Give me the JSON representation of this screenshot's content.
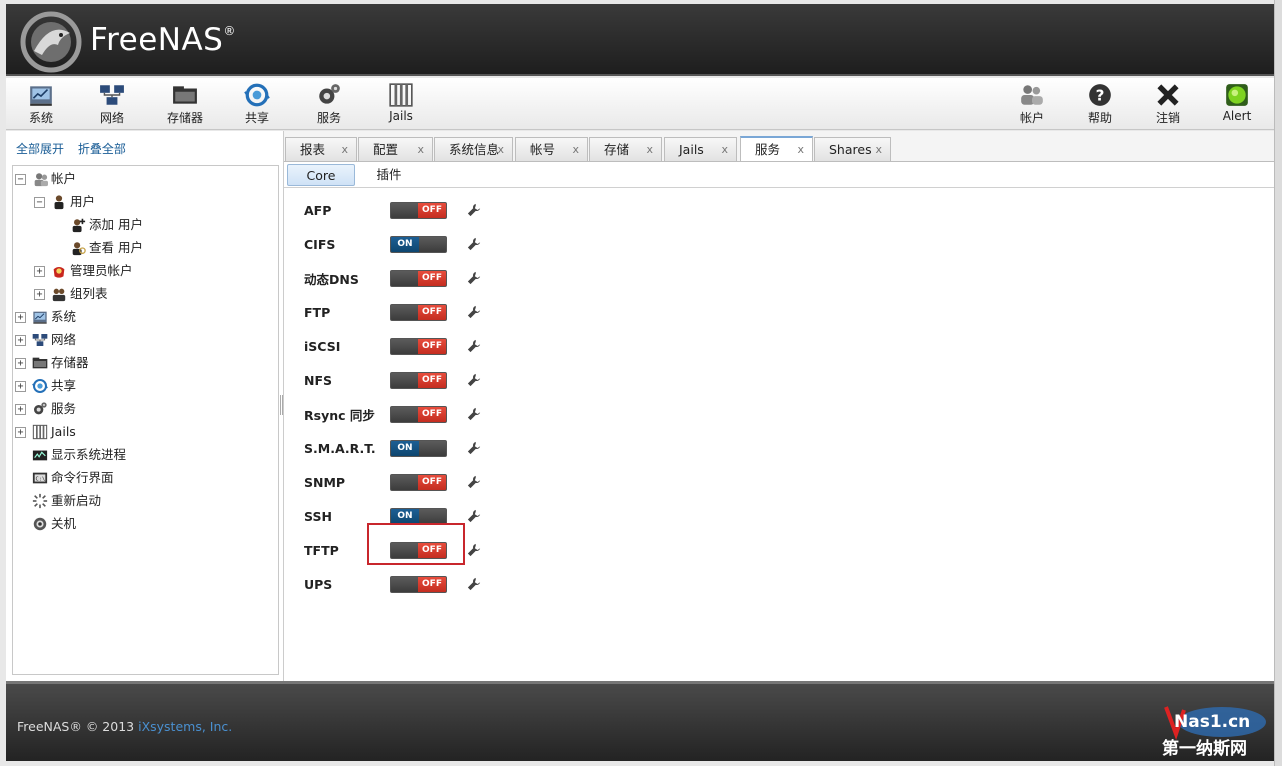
{
  "brand": {
    "name": "FreeNAS",
    "reg": "®"
  },
  "toolbar": {
    "left": [
      {
        "id": "system",
        "label": "系统",
        "icon": "system-icon"
      },
      {
        "id": "network",
        "label": "网络",
        "icon": "network-icon"
      },
      {
        "id": "storage",
        "label": "存储器",
        "icon": "storage-icon"
      },
      {
        "id": "sharing",
        "label": "共享",
        "icon": "sharing-icon"
      },
      {
        "id": "services",
        "label": "服务",
        "icon": "services-icon"
      },
      {
        "id": "jails",
        "label": "Jails",
        "icon": "jails-icon"
      }
    ],
    "right": [
      {
        "id": "account",
        "label": "帐户",
        "icon": "account-icon"
      },
      {
        "id": "help",
        "label": "帮助",
        "icon": "help-icon"
      },
      {
        "id": "logout",
        "label": "注销",
        "icon": "logout-icon"
      },
      {
        "id": "alert",
        "label": "Alert",
        "icon": "alert-icon"
      }
    ]
  },
  "sidebar": {
    "expand_all": "全部展开",
    "collapse_all": "折叠全部",
    "tree": [
      {
        "label": "帐户",
        "exp": "−",
        "icon": "accounts-icon"
      },
      {
        "label": "用户",
        "exp": "−",
        "icon": "user-icon"
      },
      {
        "label": "添加 用户",
        "exp": "",
        "icon": "add-user-icon"
      },
      {
        "label": "查看 用户",
        "exp": "",
        "icon": "view-users-icon"
      },
      {
        "label": "管理员帐户",
        "exp": "+",
        "icon": "admin-account-icon"
      },
      {
        "label": "组列表",
        "exp": "+",
        "icon": "groups-icon"
      },
      {
        "label": "系统",
        "exp": "+",
        "icon": "system-icon"
      },
      {
        "label": "网络",
        "exp": "+",
        "icon": "network-icon"
      },
      {
        "label": "存储器",
        "exp": "+",
        "icon": "storage-icon"
      },
      {
        "label": "共享",
        "exp": "+",
        "icon": "sharing-icon"
      },
      {
        "label": "服务",
        "exp": "+",
        "icon": "services-icon"
      },
      {
        "label": "Jails",
        "exp": "+",
        "icon": "jails-icon"
      },
      {
        "label": "显示系统进程",
        "exp": "",
        "icon": "process-icon"
      },
      {
        "label": "命令行界面",
        "exp": "",
        "icon": "shell-icon"
      },
      {
        "label": "重新启动",
        "exp": "",
        "icon": "reboot-icon"
      },
      {
        "label": "关机",
        "exp": "",
        "icon": "shutdown-icon"
      }
    ]
  },
  "tabs": [
    {
      "label": "报表",
      "close": "x"
    },
    {
      "label": "配置",
      "close": "x"
    },
    {
      "label": "系统信息",
      "close": "x"
    },
    {
      "label": "帐号",
      "close": "x"
    },
    {
      "label": "存储",
      "close": "x"
    },
    {
      "label": "Jails",
      "close": "x"
    },
    {
      "label": "服务",
      "close": "x",
      "active": true
    },
    {
      "label": "Shares",
      "close": "x"
    }
  ],
  "subtabs": [
    {
      "label": "Core",
      "active": true
    },
    {
      "label": "插件"
    }
  ],
  "services": [
    {
      "name": "AFP",
      "state": "OFF"
    },
    {
      "name": "CIFS",
      "state": "ON"
    },
    {
      "name": "动态DNS",
      "state": "OFF"
    },
    {
      "name": "FTP",
      "state": "OFF"
    },
    {
      "name": "iSCSI",
      "state": "OFF"
    },
    {
      "name": "NFS",
      "state": "OFF"
    },
    {
      "name": "Rsync 同步",
      "state": "OFF"
    },
    {
      "name": "S.M.A.R.T.",
      "state": "ON"
    },
    {
      "name": "SNMP",
      "state": "OFF"
    },
    {
      "name": "SSH",
      "state": "ON"
    },
    {
      "name": "TFTP",
      "state": "OFF"
    },
    {
      "name": "UPS",
      "state": "OFF"
    }
  ],
  "footer": {
    "copyright": "FreeNAS® © 2013 ",
    "company": "iXsystems, Inc.",
    "watermark_top": "Nas1.cn",
    "watermark_bottom": "第一纳斯网"
  },
  "colors": {
    "on": "#1d5f94",
    "off": "#d9382b",
    "highlight": "#c8262c",
    "link": "#1a5d96"
  }
}
